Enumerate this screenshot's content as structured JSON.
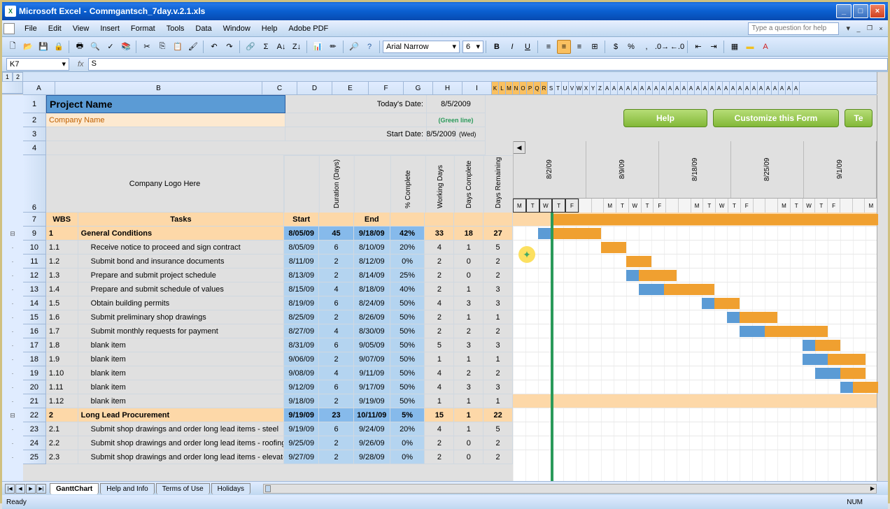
{
  "titlebar": {
    "app": "Microsoft Excel",
    "doc": "Commgantsch_7day.v.2.1.xls"
  },
  "menu": [
    "File",
    "Edit",
    "View",
    "Insert",
    "Format",
    "Tools",
    "Data",
    "Window",
    "Help",
    "Adobe PDF"
  ],
  "helpbox_placeholder": "Type a question for help",
  "font": {
    "name": "Arial Narrow",
    "size": "6"
  },
  "namebox": "K7",
  "formula": "S",
  "outline_levels": [
    "1",
    "2"
  ],
  "columns": [
    "A",
    "B",
    "C",
    "D",
    "E",
    "F",
    "G",
    "H",
    "I",
    "K",
    "L",
    "M",
    "N",
    "O",
    "P",
    "Q",
    "R",
    "S",
    "T",
    "U",
    "V",
    "W",
    "X",
    "Y",
    "Z",
    "A",
    "A",
    "A",
    "A",
    "A",
    "A",
    "A",
    "A",
    "A",
    "A",
    "A",
    "A",
    "A",
    "A",
    "A",
    "A",
    "A",
    "A",
    "A",
    "A",
    "A",
    "A",
    "A",
    "A",
    "A"
  ],
  "top": {
    "project_name": "Project Name",
    "company_name": "Company Name",
    "logo_here": "Company Logo Here",
    "todays_date_label": "Today's Date:",
    "todays_date": "8/5/2009",
    "green_line": "(Green line)",
    "start_date_label": "Start Date:",
    "start_date": "8/5/2009",
    "start_day": "(Wed)",
    "help_btn": "Help",
    "customize_btn": "Customize this Form",
    "template_btn": "Te"
  },
  "data_headers": {
    "wbs": "WBS",
    "tasks": "Tasks",
    "start": "Start",
    "duration": "Duration (Days)",
    "end": "End",
    "pct": "% Complete",
    "working": "Working Days",
    "complete": "Days Complete",
    "remaining": "Days Remaining"
  },
  "gantt": {
    "weeks": [
      "8/2/09",
      "8/9/09",
      "8/18/09",
      "8/25/09",
      "9/1/09"
    ],
    "days": [
      "M",
      "T",
      "W",
      "T",
      "F",
      "",
      "",
      "M",
      "T",
      "W",
      "T",
      "F",
      "",
      "",
      "M",
      "T",
      "W",
      "T",
      "F",
      "",
      "",
      "M",
      "T",
      "W",
      "T",
      "F",
      "",
      "",
      "M"
    ],
    "today_col": 3
  },
  "rows": [
    {
      "n": 9,
      "wbs": "1",
      "task": "General Conditions",
      "start": "8/05/09",
      "dur": "45",
      "end": "9/18/09",
      "pct": "42%",
      "wd": "33",
      "dc": "18",
      "dr": "27",
      "section": true,
      "bar": {
        "s": 3,
        "l": 26,
        "c": "orange"
      }
    },
    {
      "n": 10,
      "wbs": "1.1",
      "task": "Receive notice to proceed and sign contract",
      "start": "8/05/09",
      "dur": "6",
      "end": "8/10/09",
      "pct": "20%",
      "wd": "4",
      "dc": "1",
      "dr": "5",
      "bar": {
        "s": 3,
        "l": 4,
        "c": "orange",
        "pre": 1
      }
    },
    {
      "n": 11,
      "wbs": "1.2",
      "task": "Submit bond and insurance documents",
      "start": "8/11/09",
      "dur": "2",
      "end": "8/12/09",
      "pct": "0%",
      "wd": "2",
      "dc": "0",
      "dr": "2",
      "bar": {
        "s": 7,
        "l": 2,
        "c": "orange"
      }
    },
    {
      "n": 12,
      "wbs": "1.3",
      "task": "Prepare and submit project schedule",
      "start": "8/13/09",
      "dur": "2",
      "end": "8/14/09",
      "pct": "25%",
      "wd": "2",
      "dc": "0",
      "dr": "2",
      "bar": {
        "s": 9,
        "l": 2,
        "c": "orange"
      }
    },
    {
      "n": 13,
      "wbs": "1.4",
      "task": "Prepare and submit schedule of values",
      "start": "8/15/09",
      "dur": "4",
      "end": "8/18/09",
      "pct": "40%",
      "wd": "2",
      "dc": "1",
      "dr": "3",
      "bar": {
        "s": 10,
        "l": 3,
        "c": "orange",
        "pre": 1
      }
    },
    {
      "n": 14,
      "wbs": "1.5",
      "task": "Obtain building permits",
      "start": "8/19/09",
      "dur": "6",
      "end": "8/24/09",
      "pct": "50%",
      "wd": "4",
      "dc": "3",
      "dr": "3",
      "bar": {
        "s": 12,
        "l": 4,
        "c": "orange",
        "pre": 2
      }
    },
    {
      "n": 15,
      "wbs": "1.6",
      "task": "Submit preliminary shop drawings",
      "start": "8/25/09",
      "dur": "2",
      "end": "8/26/09",
      "pct": "50%",
      "wd": "2",
      "dc": "1",
      "dr": "1",
      "bar": {
        "s": 16,
        "l": 2,
        "c": "orange",
        "pre": 1
      }
    },
    {
      "n": 16,
      "wbs": "1.7",
      "task": "Submit monthly requests for payment",
      "start": "8/27/09",
      "dur": "4",
      "end": "8/30/09",
      "pct": "50%",
      "wd": "2",
      "dc": "2",
      "dr": "2",
      "bar": {
        "s": 18,
        "l": 3,
        "c": "orange",
        "pre": 1
      }
    },
    {
      "n": 17,
      "wbs": "1.8",
      "task": "blank item",
      "start": "8/31/09",
      "dur": "6",
      "end": "9/05/09",
      "pct": "50%",
      "wd": "5",
      "dc": "3",
      "dr": "3",
      "bar": {
        "s": 20,
        "l": 5,
        "c": "orange",
        "pre": 2
      }
    },
    {
      "n": 18,
      "wbs": "1.9",
      "task": "blank item",
      "start": "9/06/09",
      "dur": "2",
      "end": "9/07/09",
      "pct": "50%",
      "wd": "1",
      "dc": "1",
      "dr": "1",
      "bar": {
        "s": 24,
        "l": 2,
        "c": "orange",
        "pre": 1
      }
    },
    {
      "n": 19,
      "wbs": "1.10",
      "task": "blank item",
      "start": "9/08/09",
      "dur": "4",
      "end": "9/11/09",
      "pct": "50%",
      "wd": "4",
      "dc": "2",
      "dr": "2",
      "bar": {
        "s": 25,
        "l": 3,
        "c": "orange",
        "pre": 2
      }
    },
    {
      "n": 20,
      "wbs": "1.11",
      "task": "blank item",
      "start": "9/12/09",
      "dur": "6",
      "end": "9/17/09",
      "pct": "50%",
      "wd": "4",
      "dc": "3",
      "dr": "3",
      "bar": {
        "s": 26,
        "l": 2,
        "c": "orange",
        "pre": 2
      }
    },
    {
      "n": 21,
      "wbs": "1.12",
      "task": "blank item",
      "start": "9/18/09",
      "dur": "2",
      "end": "9/19/09",
      "pct": "50%",
      "wd": "1",
      "dc": "1",
      "dr": "1",
      "bar": {
        "s": 27,
        "l": 2,
        "c": "orange",
        "pre": 1
      }
    },
    {
      "n": 22,
      "wbs": "2",
      "task": "Long Lead Procurement",
      "start": "9/19/09",
      "dur": "23",
      "end": "10/11/09",
      "pct": "5%",
      "wd": "15",
      "dc": "1",
      "dr": "22",
      "section": true
    },
    {
      "n": 23,
      "wbs": "2.1",
      "task": "Submit shop drawings and order long lead items - steel",
      "start": "9/19/09",
      "dur": "6",
      "end": "9/24/09",
      "pct": "20%",
      "wd": "4",
      "dc": "1",
      "dr": "5"
    },
    {
      "n": 24,
      "wbs": "2.2",
      "task": "Submit shop drawings and order long lead items - roofing",
      "start": "9/25/09",
      "dur": "2",
      "end": "9/26/09",
      "pct": "0%",
      "wd": "2",
      "dc": "0",
      "dr": "2"
    },
    {
      "n": 25,
      "wbs": "2.3",
      "task": "Submit shop drawings and order long lead items - elevator",
      "start": "9/27/09",
      "dur": "2",
      "end": "9/28/09",
      "pct": "0%",
      "wd": "2",
      "dc": "0",
      "dr": "2"
    }
  ],
  "tabs": [
    "GanttChart",
    "Help and Info",
    "Terms of Use",
    "Holidays"
  ],
  "statusbar": {
    "ready": "Ready",
    "num": "NUM"
  }
}
